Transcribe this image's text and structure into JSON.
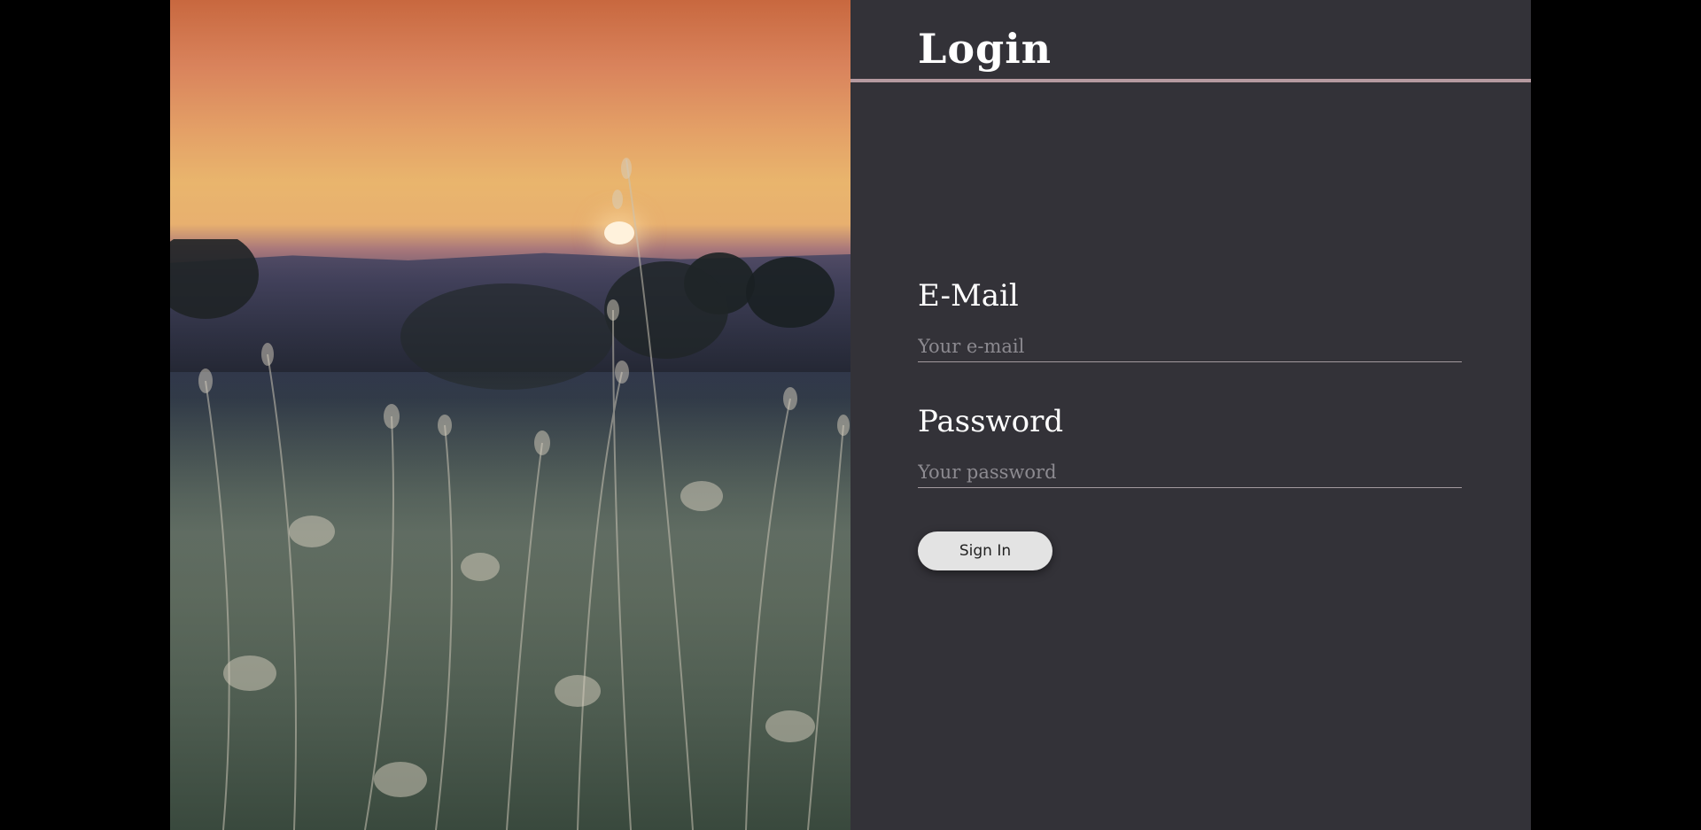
{
  "login": {
    "title": "Login",
    "email": {
      "label": "E-Mail",
      "placeholder": "Your e-mail",
      "value": ""
    },
    "password": {
      "label": "Password",
      "placeholder": "Your password",
      "value": ""
    },
    "sign_in_label": "Sign In"
  },
  "colors": {
    "background": "#000000",
    "form_panel": "#333238",
    "title_rule": "#b59aa0",
    "button": "#e3e3e3"
  },
  "icons": []
}
